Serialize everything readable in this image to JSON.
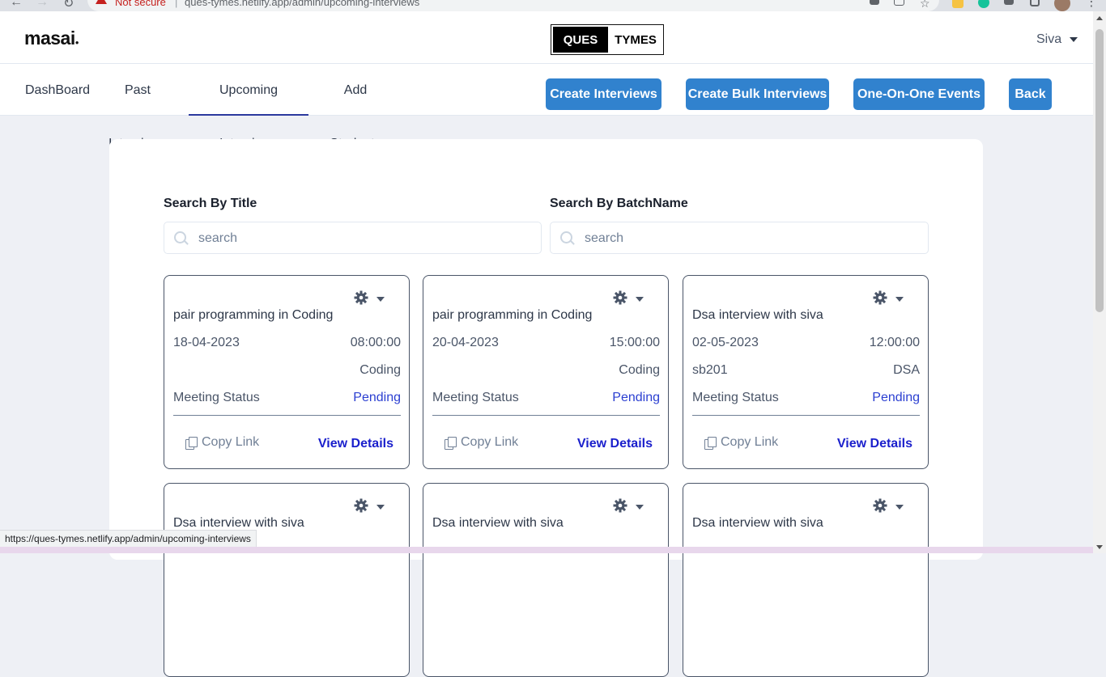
{
  "browser": {
    "security_label": "Not secure",
    "url": "ques-tymes.netlify.app/admin/upcoming-interviews",
    "status_url": "https://ques-tymes.netlify.app/admin/upcoming-interviews"
  },
  "header": {
    "logo": "masai",
    "brand_left": "QUES",
    "brand_right": "TYMES",
    "user_name": "Siva"
  },
  "nav": {
    "tabs": [
      {
        "label": "DashBoard",
        "active": false
      },
      {
        "label": "Past Interviews",
        "active": false
      },
      {
        "label": "Upcoming Interviews",
        "active": true
      },
      {
        "label": "Add Students",
        "active": false
      }
    ],
    "buttons": [
      {
        "label": "Create Interviews"
      },
      {
        "label": "Create Bulk Interviews"
      },
      {
        "label": "One-On-One Events"
      },
      {
        "label": "Back"
      }
    ]
  },
  "search": {
    "title_label": "Search By Title",
    "title_placeholder": "search",
    "batch_label": "Search By BatchName",
    "batch_placeholder": "search"
  },
  "cards": [
    {
      "title": "pair programming in Coding",
      "date": "18-04-2023",
      "time": "08:00:00",
      "batch": "",
      "category": "Coding",
      "status_label": "Meeting Status",
      "status": "Pending",
      "copy_label": "Copy Link",
      "view_label": "View Details"
    },
    {
      "title": "pair programming in Coding",
      "date": "20-04-2023",
      "time": "15:00:00",
      "batch": "",
      "category": "Coding",
      "status_label": "Meeting Status",
      "status": "Pending",
      "copy_label": "Copy Link",
      "view_label": "View Details"
    },
    {
      "title": "Dsa interview with siva",
      "date": "02-05-2023",
      "time": "12:00:00",
      "batch": "sb201",
      "category": "DSA",
      "status_label": "Meeting Status",
      "status": "Pending",
      "copy_label": "Copy Link",
      "view_label": "View Details"
    },
    {
      "title": "Dsa interview with siva"
    },
    {
      "title": "Dsa interview with siva"
    },
    {
      "title": "Dsa interview with siva"
    }
  ],
  "colors": {
    "primary_button": "#3182ce",
    "pending": "#2b3fd1",
    "view_details": "#1a1fcc",
    "active_tab_underline": "#2b3a9e"
  }
}
